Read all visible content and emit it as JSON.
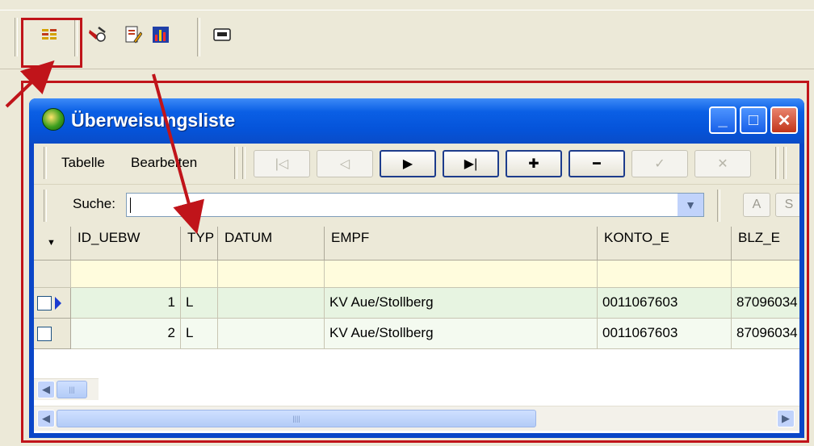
{
  "window": {
    "title": "Überweisungsliste",
    "controls": {
      "minimize": "_",
      "maximize": "□",
      "close": "✕"
    }
  },
  "menu": {
    "items": [
      "Tabelle",
      "Bearbeiten"
    ]
  },
  "navigator": {
    "buttons": [
      {
        "name": "first",
        "glyph": "|◁",
        "enabled": false
      },
      {
        "name": "prior",
        "glyph": "◁",
        "enabled": false
      },
      {
        "name": "next",
        "glyph": "▶",
        "enabled": true
      },
      {
        "name": "last",
        "glyph": "▶|",
        "enabled": true
      },
      {
        "name": "insert",
        "glyph": "✚",
        "enabled": true
      },
      {
        "name": "delete",
        "glyph": "━",
        "enabled": true
      },
      {
        "name": "post",
        "glyph": "✓",
        "enabled": false
      },
      {
        "name": "cancel",
        "glyph": "✕",
        "enabled": false
      }
    ]
  },
  "search": {
    "label": "Suche:",
    "value": "",
    "buttons": [
      "A",
      "S"
    ]
  },
  "grid": {
    "columns": [
      "ID_UEBW",
      "TYP",
      "DATUM",
      "EMPF",
      "KONTO_E",
      "BLZ_E"
    ],
    "rows": [
      [
        "1",
        "L",
        "",
        "KV Aue/Stollberg",
        "0011067603",
        "87096034"
      ],
      [
        "2",
        "L",
        "",
        "KV Aue/Stollberg",
        "0011067603",
        "87096034"
      ]
    ]
  },
  "annotation": {
    "color": "#c0141a"
  },
  "icons": [
    "report-list-icon",
    "tools-icon",
    "edit-document-icon",
    "chart-icon",
    "dialog-icon"
  ]
}
